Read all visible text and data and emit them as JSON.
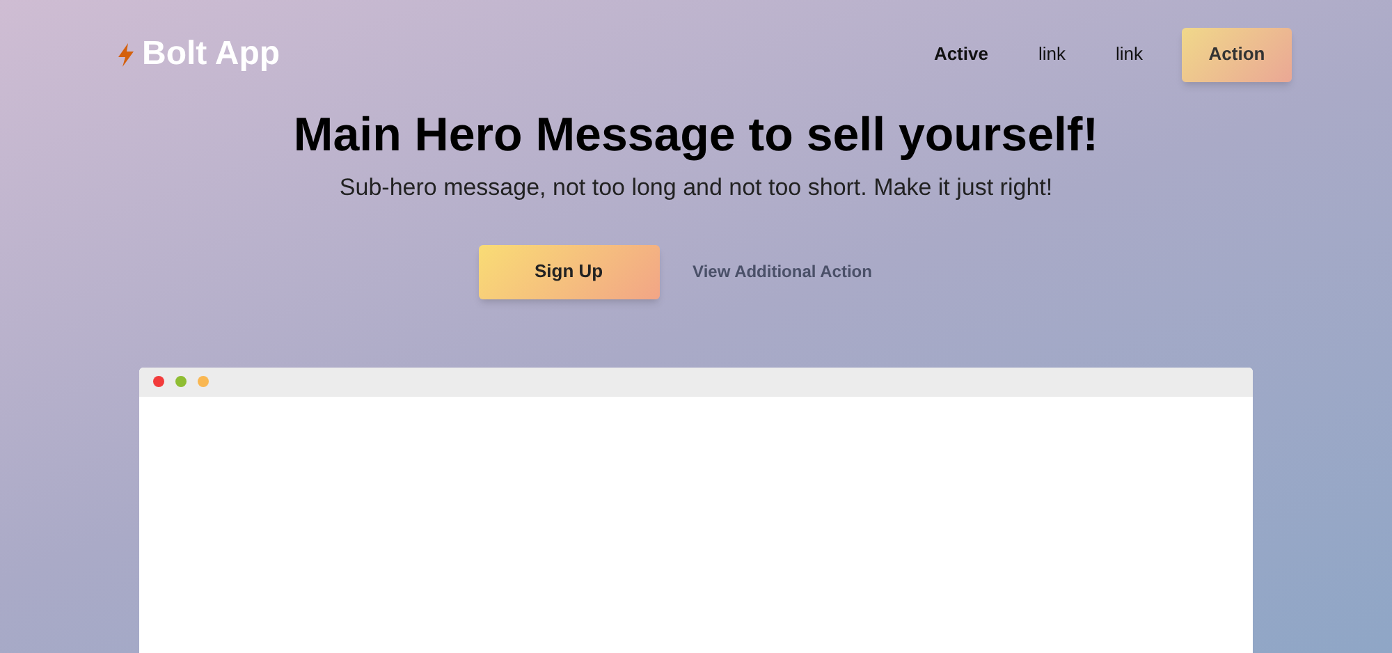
{
  "brand": {
    "name": "Bolt App"
  },
  "nav": [
    {
      "label": "Active",
      "selected": true
    },
    {
      "label": "link",
      "selected": false
    },
    {
      "label": "link",
      "selected": false
    }
  ],
  "nav_action": "Action",
  "hero": {
    "title": "Main Hero Message to sell yourself!",
    "subtitle": "Sub-hero message, not too long and not too short. Make it just right!"
  },
  "primary_button": "Sign Up",
  "secondary_link": "View Additional Action",
  "browser_window": {
    "dots": [
      {
        "color": "#f23b3b"
      },
      {
        "color": "#8fbd33"
      },
      {
        "color": "#f9b752"
      }
    ]
  }
}
